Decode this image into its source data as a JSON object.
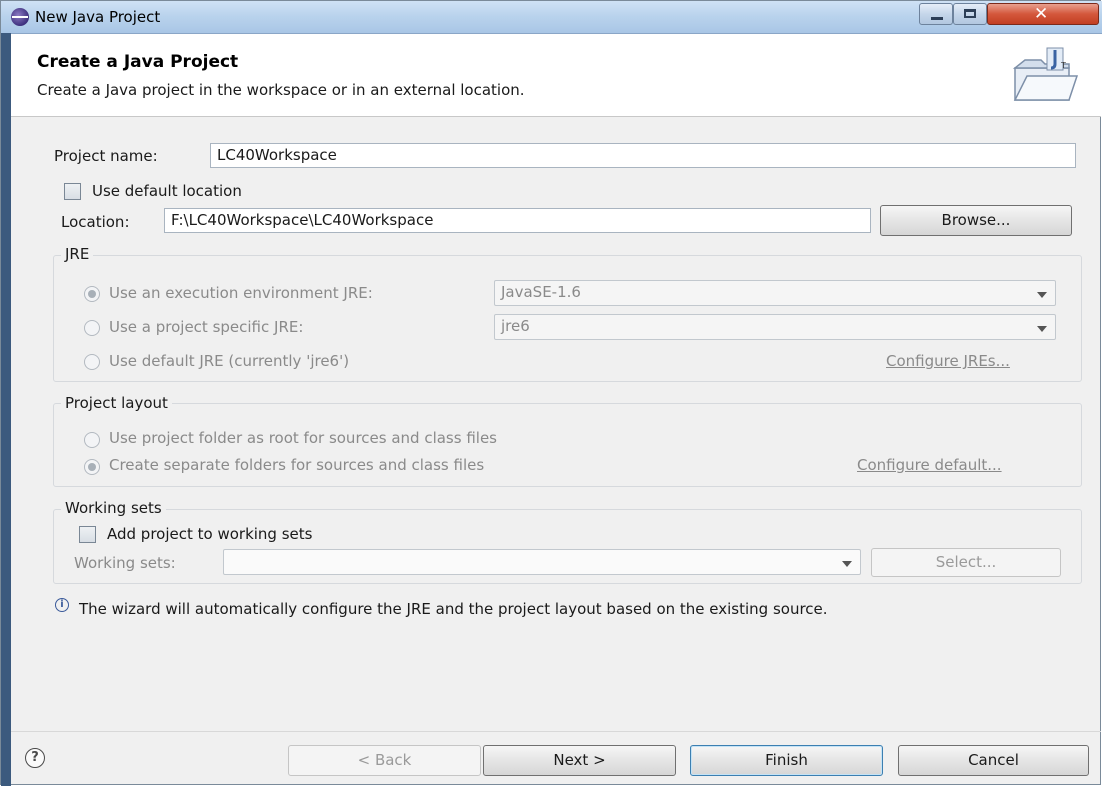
{
  "window": {
    "title": "New Java Project",
    "controls": {
      "minimize": "minimize-icon",
      "maximize": "maximize-icon",
      "close": "close-icon",
      "close_glyph": "✕"
    }
  },
  "header": {
    "title": "Create a Java Project",
    "description": "Create a Java project in the workspace or in an external location.",
    "icon": "new-java-project-wizard-icon"
  },
  "project": {
    "name_label": "Project name:",
    "name_value": "LC40Workspace",
    "default_location_label": "Use default location",
    "default_location_checked": false,
    "location_label": "Location:",
    "location_value": "F:\\LC40Workspace\\LC40Workspace",
    "browse_label": "Browse..."
  },
  "jre": {
    "group_title": "JRE",
    "exec_env_label": "Use an execution environment JRE:",
    "exec_env_value": "JavaSE-1.6",
    "exec_env_selected": true,
    "project_specific_label": "Use a project specific JRE:",
    "project_specific_value": "jre6",
    "default_jre_label": "Use default JRE (currently 'jre6')",
    "configure_link": "Configure JREs..."
  },
  "layout": {
    "group_title": "Project layout",
    "root_option": "Use project folder as root for sources and class files",
    "separate_option": "Create separate folders for sources and class files",
    "separate_selected": true,
    "configure_link": "Configure default..."
  },
  "working_sets": {
    "group_title": "Working sets",
    "add_label": "Add project to working sets",
    "add_checked": false,
    "sets_label": "Working sets:",
    "sets_value": "",
    "select_label": "Select..."
  },
  "info": {
    "icon": "info-icon",
    "message": "The wizard will automatically configure the JRE and the project layout based on the existing source."
  },
  "footer": {
    "help_glyph": "?",
    "back_label": "< Back",
    "next_label": "Next >",
    "finish_label": "Finish",
    "cancel_label": "Cancel"
  }
}
